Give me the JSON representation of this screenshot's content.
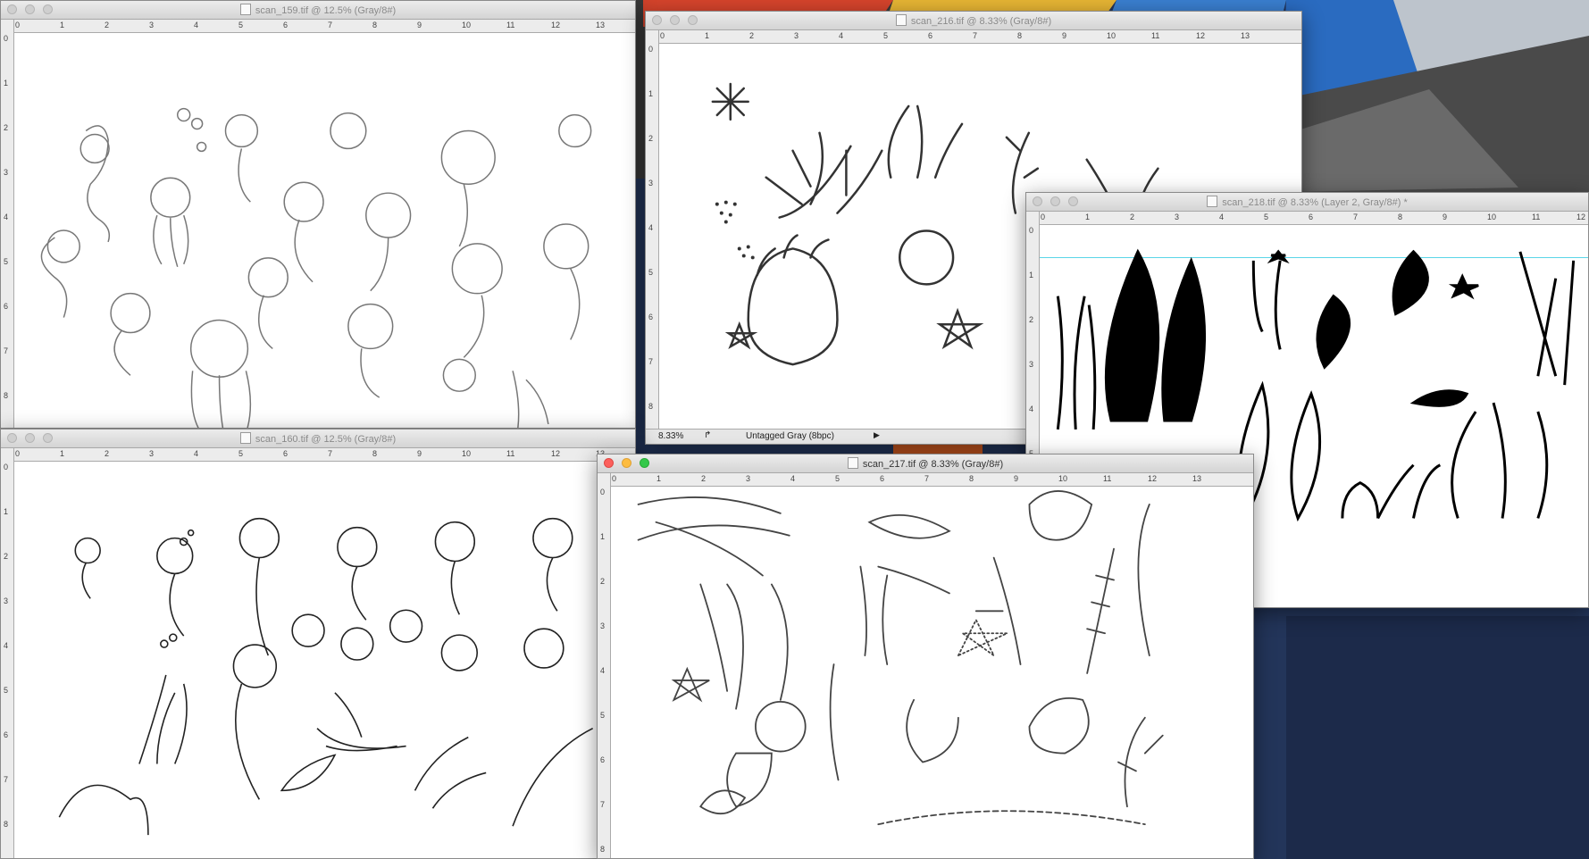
{
  "windows": {
    "scan_159": {
      "title": "scan_159.tif @ 12.5% (Gray/8#)"
    },
    "scan_216": {
      "title": "scan_216.tif @ 8.33% (Gray/8#)",
      "zoom": "8.33%",
      "profile": "Untagged Gray (8bpc)"
    },
    "scan_218": {
      "title": "scan_218.tif @ 8.33% (Layer 2, Gray/8#) *"
    },
    "scan_160": {
      "title": "scan_160.tif @ 12.5% (Gray/8#)"
    },
    "scan_217": {
      "title": "scan_217.tif @ 8.33% (Gray/8#)"
    }
  },
  "rulers": {
    "h_ticks": [
      "0",
      "1",
      "2",
      "3",
      "4",
      "5",
      "6",
      "7",
      "8",
      "9",
      "10",
      "11",
      "12",
      "13"
    ],
    "v_ticks": [
      "0",
      "1",
      "2",
      "3",
      "4",
      "5",
      "6",
      "7",
      "8"
    ]
  },
  "colors": {
    "desktop_bg": "#2d3d5e",
    "accent_cyan": "#5ad6e8"
  }
}
